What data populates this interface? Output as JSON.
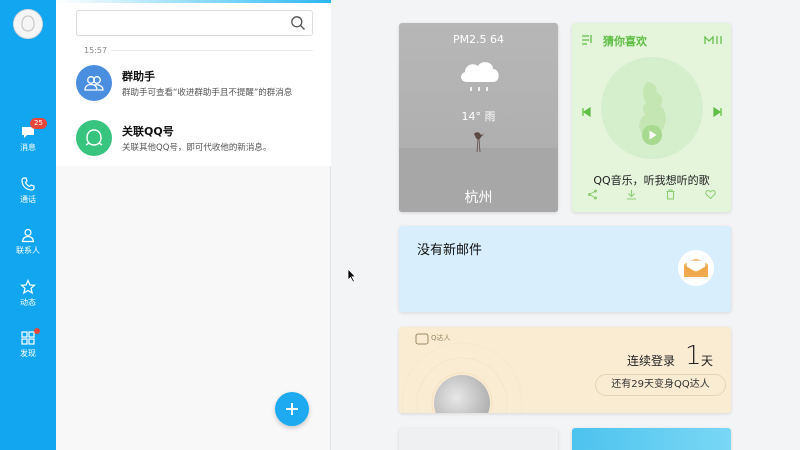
{
  "nav": {
    "items": [
      {
        "label": "消息",
        "badge": "25",
        "icon": "chat-bubble-icon"
      },
      {
        "label": "通话",
        "icon": "phone-icon"
      },
      {
        "label": "联系人",
        "icon": "contact-icon"
      },
      {
        "label": "动态",
        "icon": "star-icon"
      },
      {
        "label": "发现",
        "icon": "grid-icon"
      }
    ]
  },
  "list": {
    "time": "15:57",
    "items": [
      {
        "title": "群助手",
        "desc": "群助手可查看“收进群助手且不提醒”的群消息",
        "icon": "group-assistant-icon",
        "color": "#4a8ee0"
      },
      {
        "title": "关联QQ号",
        "desc": "关联其他QQ号，即可代收他的新消息。",
        "icon": "linked-accounts-icon",
        "color": "#36c47e"
      }
    ]
  },
  "weather": {
    "pm": "PM2.5 64",
    "temp": "14° 雨",
    "city": "杭州"
  },
  "music": {
    "title": "猜你喜欢",
    "caption": "QQ音乐，听我想听的歌",
    "accent": "#5fbe44"
  },
  "mail": {
    "text": "没有新邮件"
  },
  "login": {
    "tag": "Q达人",
    "prefix": "连续登录",
    "days": "1",
    "suffix": "天",
    "sub": "还有29天变身QQ达人"
  },
  "colors": {
    "nav": "#12a6f0",
    "fab": "#1eaaf1"
  }
}
